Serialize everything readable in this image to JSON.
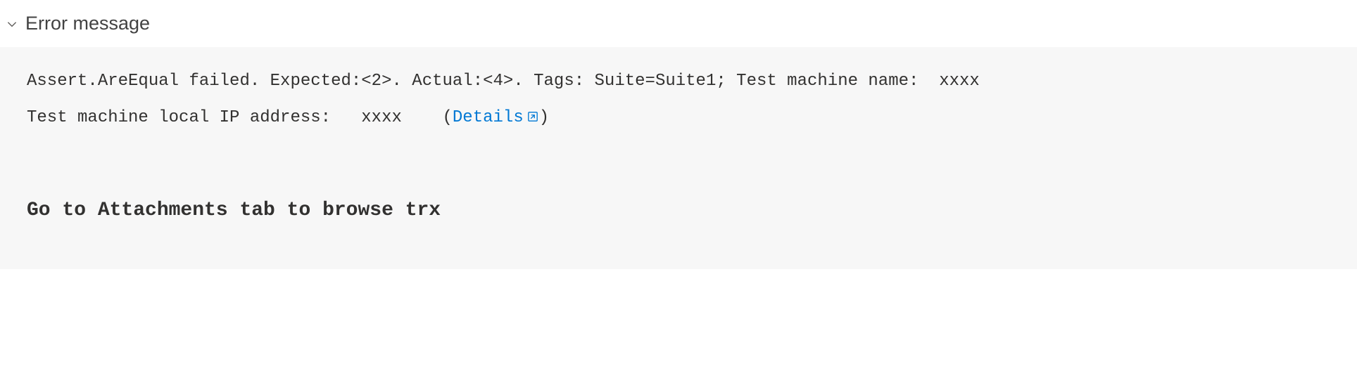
{
  "section": {
    "title": "Error message"
  },
  "error": {
    "line1_prefix": "Assert.AreEqual failed. Expected:<2>. Actual:<4>. Tags: Suite=Suite1; Test machine name:  ",
    "line1_masked": "xxxx",
    "line2_prefix": "Test machine local IP address:   ",
    "line2_masked": "xxxx",
    "details_label": "Details",
    "attachments_hint": "Go to Attachments tab to browse trx"
  }
}
